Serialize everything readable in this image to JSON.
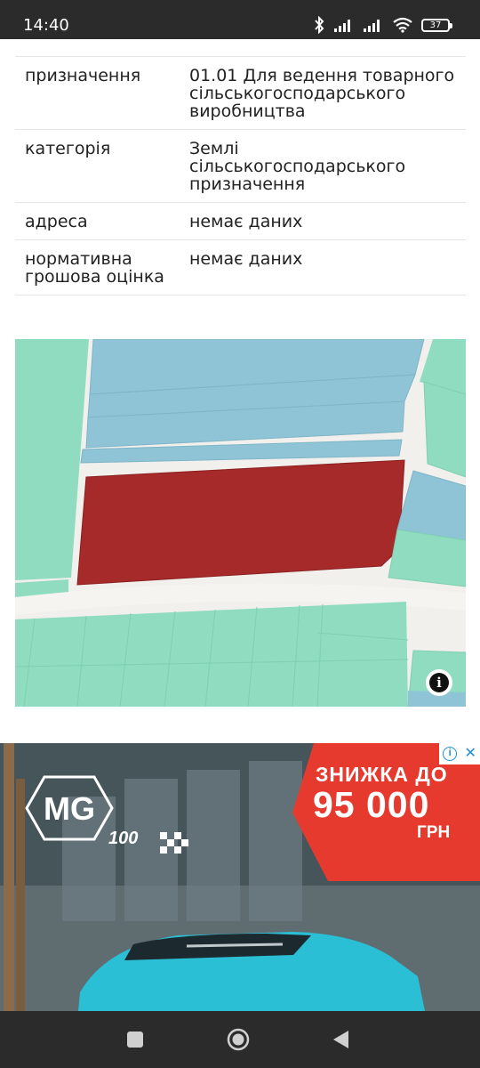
{
  "status_bar": {
    "time": "14:40",
    "battery": "37",
    "icons": [
      "bluetooth-icon",
      "signal-icon",
      "signal-icon",
      "wifi-icon",
      "battery-icon"
    ]
  },
  "info_rows": [
    {
      "label": "призначення",
      "value": "01.01 Для ведення товарного сільськогосподарського виробництва"
    },
    {
      "label": "категорія",
      "value": "Землі сільськогосподарського призначення"
    },
    {
      "label": "адреса",
      "value": "немає даних"
    },
    {
      "label": "нормативна грошова оцінка",
      "value": "немає даних"
    }
  ],
  "map": {
    "info_button": "i",
    "colors": {
      "water_blue": "#8fc4d6",
      "green": "#8fdcc0",
      "highlight": "#a62a2a",
      "road": "#f4f2ee"
    }
  },
  "ad": {
    "promo_line1": "ЗНИЖКА ДО",
    "promo_line2": "95 000",
    "promo_line3": "ГРН",
    "brand": "MG",
    "model_tag": "100",
    "colors": {
      "promo": "#e63a2e",
      "badge": "#1a8fd6"
    }
  },
  "nav_bar": {
    "buttons": [
      "recents-button",
      "home-button",
      "back-button"
    ]
  }
}
